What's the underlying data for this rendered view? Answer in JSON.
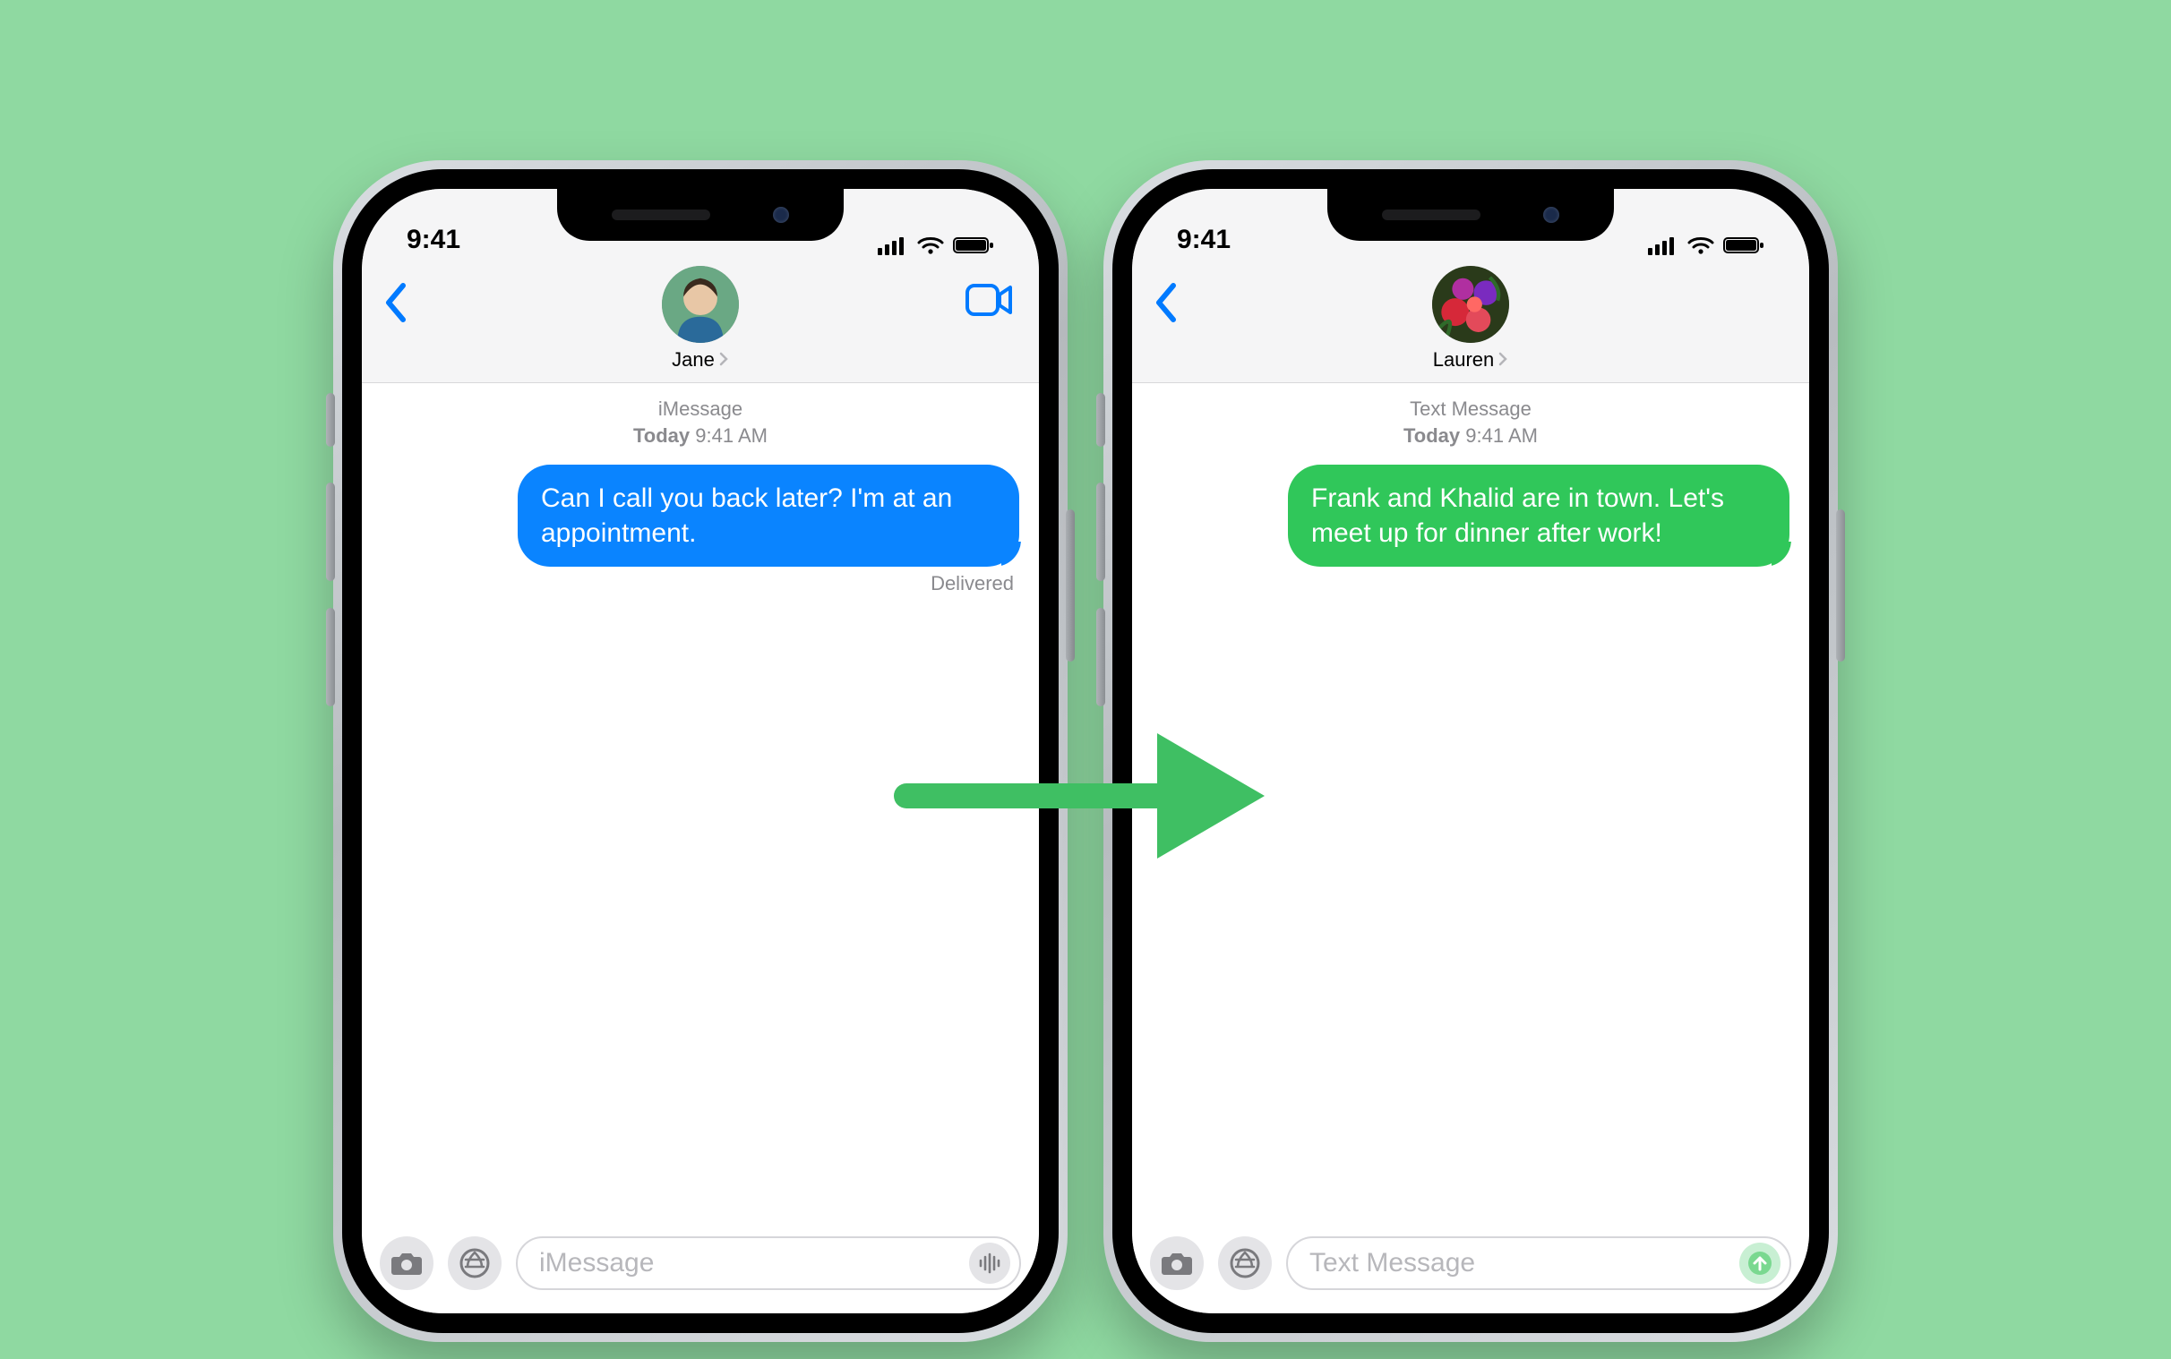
{
  "left": {
    "status_time": "9:41",
    "contact_name": "Jane",
    "meta_type": "iMessage",
    "meta_day": "Today",
    "meta_time": "9:41 AM",
    "bubble_text": "Can I call you back later? I'm at an appointment.",
    "delivered_label": "Delivered",
    "compose_placeholder": "iMessage",
    "show_video": true,
    "bubble_color": "blue",
    "send_style": "voice",
    "avatar_kind": "person"
  },
  "right": {
    "status_time": "9:41",
    "contact_name": "Lauren",
    "meta_type": "Text Message",
    "meta_day": "Today",
    "meta_time": "9:41 AM",
    "bubble_text": "Frank and Khalid are in town. Let's meet up for dinner after work!",
    "delivered_label": "",
    "compose_placeholder": "Text Message",
    "show_video": false,
    "bubble_color": "green",
    "send_style": "arrow",
    "avatar_kind": "flowers"
  }
}
